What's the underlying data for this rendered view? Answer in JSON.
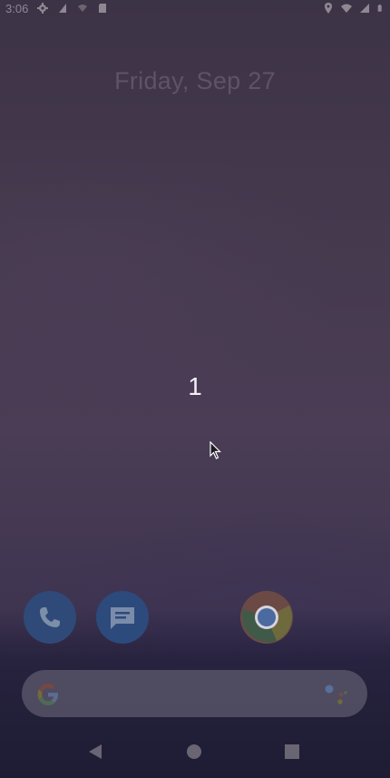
{
  "status_bar": {
    "time": "3:06",
    "icons_left": [
      "settings-icon",
      "data-icon",
      "signal-off-icon",
      "sd-card-icon"
    ],
    "icons_right": [
      "location-icon",
      "wifi-icon",
      "cell-signal-icon",
      "battery-icon"
    ]
  },
  "home": {
    "date": "Friday, Sep 27",
    "overlay_number": "1"
  },
  "dock": {
    "apps": [
      "phone-icon",
      "messages-icon",
      "chrome-icon"
    ]
  },
  "search": {
    "left_icon": "google-g-icon",
    "right_icon": "assistant-icon"
  },
  "navigation": {
    "buttons": [
      "back-icon",
      "home-icon",
      "recents-icon"
    ]
  },
  "colors": {
    "background": "#45394e",
    "date_text": "#5d5468",
    "overlay_text": "#f2f0f4"
  }
}
